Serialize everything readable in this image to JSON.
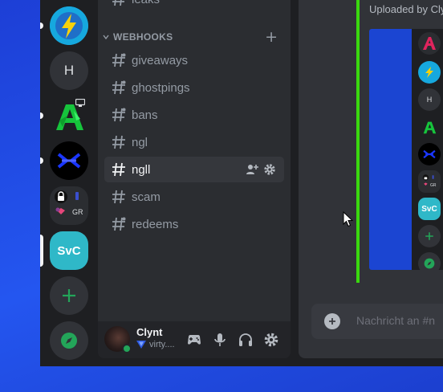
{
  "servers": [
    {
      "name": "bolt-server",
      "label": ""
    },
    {
      "name": "h-server",
      "label": "H"
    },
    {
      "name": "green-a-server",
      "label": ""
    },
    {
      "name": "x-server",
      "label": ""
    },
    {
      "name": "server-folder",
      "label": "GR"
    },
    {
      "name": "svc-server",
      "label": "SvC"
    },
    {
      "name": "add-server",
      "label": "+"
    },
    {
      "name": "explore-servers",
      "label": ""
    }
  ],
  "sidebar": {
    "partial_channel": "leaks",
    "category": "WEBHOOKS",
    "channels": [
      {
        "label": "giveaways"
      },
      {
        "label": "ghostpings"
      },
      {
        "label": "bans"
      },
      {
        "label": "ngl"
      },
      {
        "label": "ngll"
      },
      {
        "label": "scam"
      },
      {
        "label": "redeems"
      }
    ]
  },
  "user": {
    "name": "Clynt",
    "status": "virty...."
  },
  "main": {
    "uploaded_by": "Uploaded by Cly",
    "message_placeholder": "Nachricht an #n",
    "mini_rail": {
      "h_label": "H",
      "svc_label": "SvC",
      "gr_label": "GR"
    }
  },
  "colors": {
    "background": "#1d3fd6",
    "accent_green": "#3ad80f",
    "svc_teal": "#2fb8c8",
    "online": "#23a559"
  }
}
